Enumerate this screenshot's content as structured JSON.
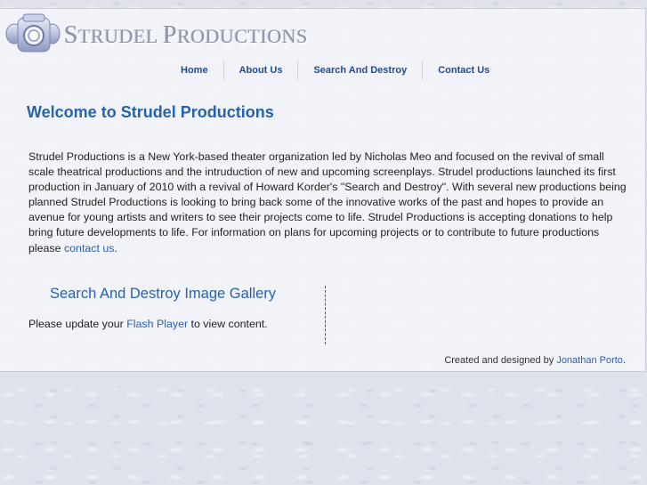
{
  "logo": {
    "big_s": "S",
    "rest1": "TRUDEL ",
    "big_p": "P",
    "rest2": "RODUCTIONS",
    "icon": "camera-icon"
  },
  "nav": {
    "items": [
      {
        "label": "Home"
      },
      {
        "label": "About Us"
      },
      {
        "label": "Search And Destroy"
      },
      {
        "label": "Contact Us"
      }
    ]
  },
  "main": {
    "title": "Welcome to Strudel Productions",
    "intro_text": "Strudel Productions is a New York-based theater organization led by Nicholas Meo and focused on the revival of small scale theatrical productions and the intruduction of new and upcoming screenplays. Strudel productions launched its first production in January of 2010 with a revival of Howard Korder's \"Search and Destroy\".   With several new productions being planned Strudel Productions is looking to bring back some of the innovative works of the past and hopes to provide an avenue for young artists and writers to see their projects come to life.   Strudel Productions is accepting donations to help bring future developments to life.  For information on plans for upcoming projects or to contribute to future productions  please ",
    "contact_link": "contact us",
    "intro_end": "."
  },
  "gallery": {
    "title": "Search And Destroy Image Gallery",
    "flash_prefix": "Please update your ",
    "flash_link": "Flash Player",
    "flash_suffix": " to view content."
  },
  "footer": {
    "prefix": "Created and designed by ",
    "author_link": "Jonathan Porto",
    "suffix": "."
  },
  "colors": {
    "accent": "#2563ad",
    "link": "#2b5fb5",
    "nav": "#1f4a94"
  }
}
